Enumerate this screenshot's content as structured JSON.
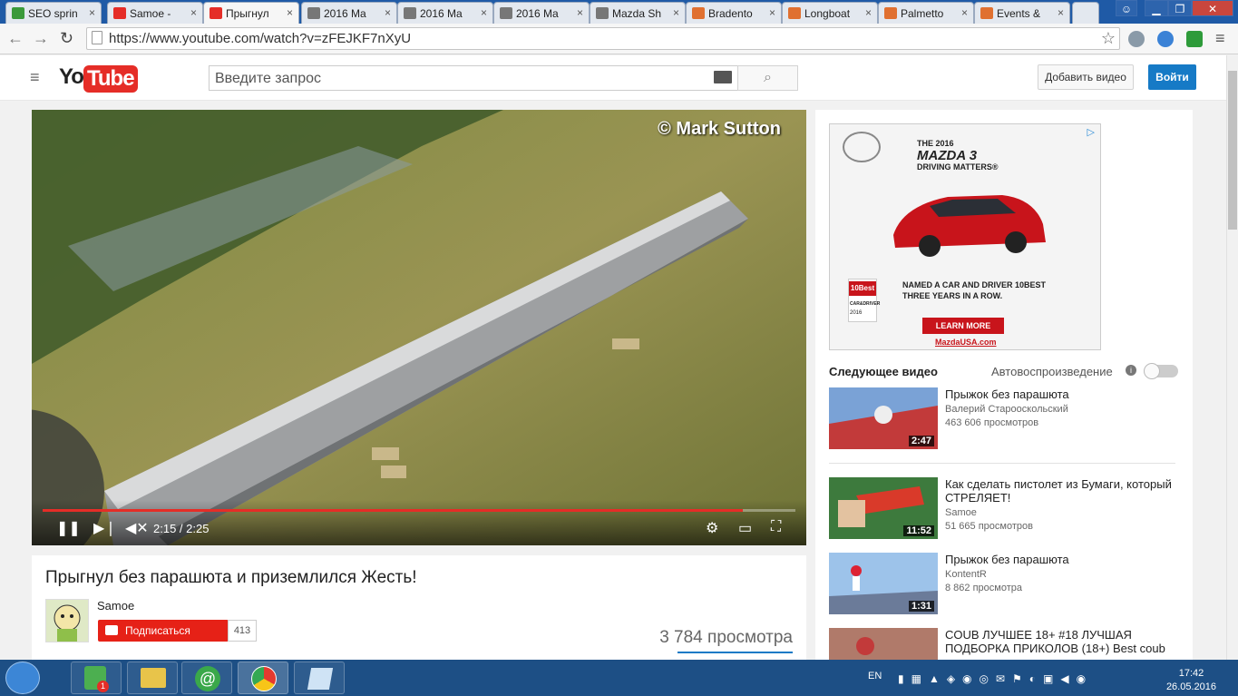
{
  "browser": {
    "tabs": [
      {
        "label": "SEO sprin",
        "color": "#3a9a3a"
      },
      {
        "label": "Samoe -",
        "color": "#e52d27"
      },
      {
        "label": "Прыгнул",
        "color": "#e52d27"
      },
      {
        "label": "2016 Ma",
        "color": "#777777"
      },
      {
        "label": "2016 Ma",
        "color": "#777777"
      },
      {
        "label": "2016 Ma",
        "color": "#777777"
      },
      {
        "label": "Mazda Sh",
        "color": "#777777"
      },
      {
        "label": "Bradento",
        "color": "#e07030"
      },
      {
        "label": "Longboat",
        "color": "#e07030"
      },
      {
        "label": "Palmetto",
        "color": "#e07030"
      },
      {
        "label": "Events &",
        "color": "#e07030"
      }
    ],
    "url": "https://www.youtube.com/watch?v=zFEJKF7nXyU",
    "close_glyph": "×"
  },
  "youtube": {
    "logo_you": "You",
    "logo_tube": "Tube",
    "search_placeholder": "Введите запрос",
    "upload_label": "Добавить видео",
    "signin_label": "Войти"
  },
  "player": {
    "watermark": "© Mark Sutton",
    "time": "2:15 / 2:25",
    "progress": 0.93
  },
  "video": {
    "title": "Прыгнул без парашюта и приземлился Жесть!",
    "channel": "Samoe",
    "subscribe_label": "Подписаться",
    "subscriber_count": "413",
    "views": "3 784 просмотра"
  },
  "ad": {
    "headline_1": "THE 2016",
    "headline_2": "MAZDA 3",
    "headline_3": "DRIVING MATTERS®",
    "badge_title": "10Best",
    "badge_sub": "CAR&DRIVER",
    "badge_year": "2016",
    "named_1": "NAMED A CAR AND DRIVER 10BEST",
    "named_2": "THREE YEARS IN A ROW.",
    "cta": "LEARN MORE",
    "link": "MazdaUSA.com"
  },
  "sidebar": {
    "up_next": "Следующее видео",
    "autoplay": "Автовоспроизведение",
    "autoplay_on": false,
    "related": [
      {
        "title": "Прыжок без парашюта",
        "channel": "Валерий Старооскольский",
        "views": "463 606 просмотров",
        "duration": "2:47"
      },
      {
        "title": "Как сделать пистолет из Бумаги, который СТРЕЛЯЕТ!",
        "channel": "Samoe",
        "views": "51 665 просмотров",
        "duration": "11:52"
      },
      {
        "title": "Прыжок без парашюта",
        "channel": "KontentR",
        "views": "8 862 просмотра",
        "duration": "1:31"
      },
      {
        "title": "COUB ЛУЧШЕЕ 18+ #18 ЛУЧШАЯ ПОДБОРКА ПРИКОЛОВ (18+) Best coub",
        "channel": "",
        "views": "",
        "duration": ""
      }
    ]
  },
  "taskbar": {
    "language": "EN",
    "time": "17:42",
    "date": "26.05.2016",
    "badge": "1"
  }
}
